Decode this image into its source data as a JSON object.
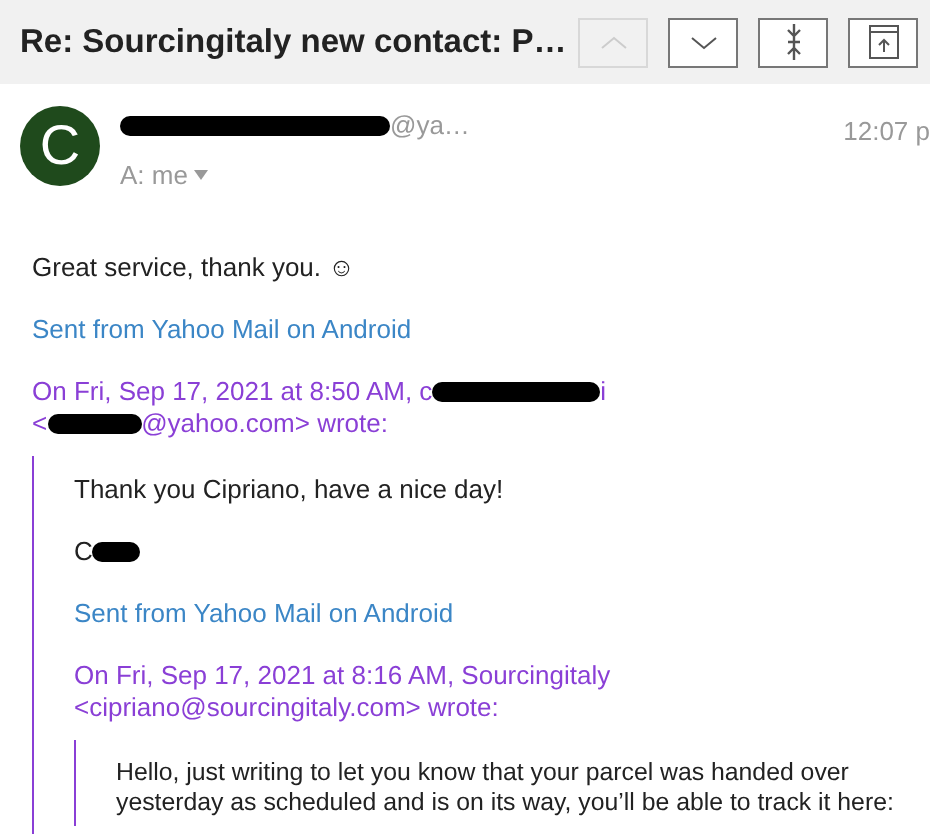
{
  "header": {
    "title": "Re: Sourcingitaly new contact: P…",
    "buttons": [
      {
        "kind": "up",
        "disabled": true
      },
      {
        "kind": "down",
        "disabled": false
      },
      {
        "kind": "collapse",
        "disabled": false
      },
      {
        "kind": "popout",
        "disabled": false
      }
    ]
  },
  "message": {
    "avatar": "C",
    "sender": [
      {
        "kind": "redacted"
      },
      {
        "kind": "text",
        "text": "@ya…"
      }
    ],
    "to": "A: me",
    "time": "12:07 p",
    "body": "Great service, thank you. ☺",
    "signature": "Sent from Yahoo Mail on Android",
    "quote": {
      "attribution": [
        {
          "kind": "text",
          "text": "On Fri, Sep 17, 2021 at 8:50 AM, c"
        },
        {
          "kind": "redacted"
        },
        {
          "kind": "text",
          "text": "i"
        },
        {
          "kind": "break"
        },
        {
          "kind": "text",
          "text": "<"
        },
        {
          "kind": "redacted"
        },
        {
          "kind": "text",
          "text": "@yahoo.com> wrote:"
        }
      ],
      "body": "Thank you Cipriano, have a nice day!",
      "sign_off": [
        {
          "kind": "text",
          "text": "C"
        },
        {
          "kind": "redacted"
        }
      ],
      "signature": "Sent from Yahoo Mail on Android",
      "quote": {
        "attribution": [
          {
            "kind": "text",
            "text": "On Fri, Sep 17, 2021 at 8:16 AM, Sourcingitaly"
          },
          {
            "kind": "break"
          },
          {
            "kind": "text",
            "text": "<cipriano@sourcingitaly.com> wrote:"
          }
        ],
        "body": "Hello, just writing to let you know that your parcel was handed over yesterday as scheduled and is on its way, you’ll be able to track it here:"
      }
    }
  }
}
